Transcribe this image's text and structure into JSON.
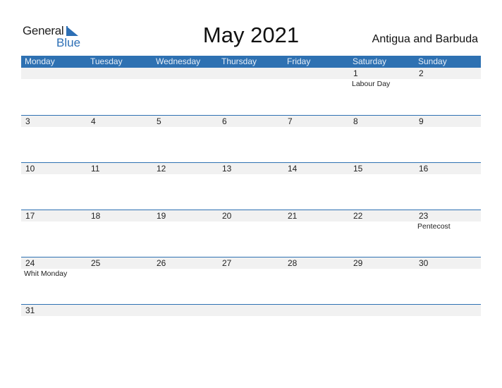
{
  "logo": {
    "general": "General",
    "blue": "Blue"
  },
  "title": "May 2021",
  "country": "Antigua and Barbuda",
  "colors": {
    "accent": "#2e71b2",
    "band": "#f1f1f1"
  },
  "weekdays": [
    "Monday",
    "Tuesday",
    "Wednesday",
    "Thursday",
    "Friday",
    "Saturday",
    "Sunday"
  ],
  "weeks": [
    [
      {
        "d": ""
      },
      {
        "d": ""
      },
      {
        "d": ""
      },
      {
        "d": ""
      },
      {
        "d": ""
      },
      {
        "d": "1",
        "h": "Labour Day"
      },
      {
        "d": "2"
      }
    ],
    [
      {
        "d": "3"
      },
      {
        "d": "4"
      },
      {
        "d": "5"
      },
      {
        "d": "6"
      },
      {
        "d": "7"
      },
      {
        "d": "8"
      },
      {
        "d": "9"
      }
    ],
    [
      {
        "d": "10"
      },
      {
        "d": "11"
      },
      {
        "d": "12"
      },
      {
        "d": "13"
      },
      {
        "d": "14"
      },
      {
        "d": "15"
      },
      {
        "d": "16"
      }
    ],
    [
      {
        "d": "17"
      },
      {
        "d": "18"
      },
      {
        "d": "19"
      },
      {
        "d": "20"
      },
      {
        "d": "21"
      },
      {
        "d": "22"
      },
      {
        "d": "23",
        "h": "Pentecost"
      }
    ],
    [
      {
        "d": "24",
        "h": "Whit Monday"
      },
      {
        "d": "25"
      },
      {
        "d": "26"
      },
      {
        "d": "27"
      },
      {
        "d": "28"
      },
      {
        "d": "29"
      },
      {
        "d": "30"
      }
    ],
    [
      {
        "d": "31"
      },
      {
        "d": ""
      },
      {
        "d": ""
      },
      {
        "d": ""
      },
      {
        "d": ""
      },
      {
        "d": ""
      },
      {
        "d": ""
      }
    ]
  ]
}
